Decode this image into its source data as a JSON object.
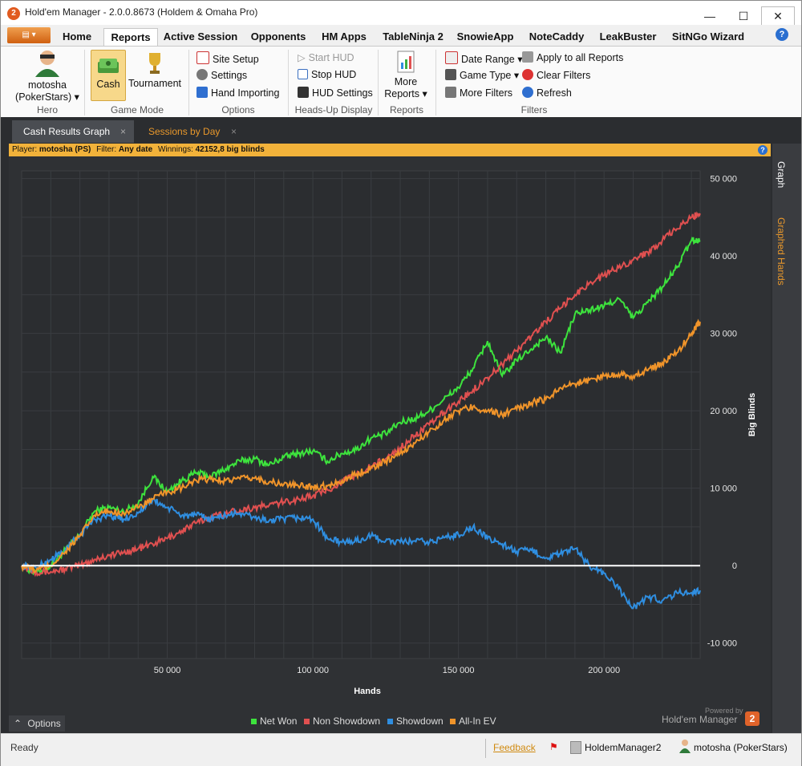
{
  "window": {
    "title": "Hold'em Manager - 2.0.0.8673 (Holdem & Omaha Pro)",
    "app_icon": "2",
    "minimize": "—",
    "maximize": "☐",
    "close": "✕"
  },
  "menu_tabs": [
    "Home",
    "Reports",
    "Active Session",
    "Opponents",
    "HM Apps",
    "TableNinja 2",
    "SnowieApp",
    "NoteCaddy",
    "LeakBuster",
    "SitNGo Wizard"
  ],
  "active_tab": "Reports",
  "ribbon": {
    "hero": {
      "name": "motosha",
      "site": "(PokerStars)",
      "label": "Hero"
    },
    "game_mode": {
      "cash": "Cash",
      "tournament": "Tournament",
      "label": "Game Mode"
    },
    "options": {
      "site_setup": "Site Setup",
      "settings": "Settings",
      "hand_importing": "Hand Importing",
      "label": "Options"
    },
    "hud": {
      "start": "Start HUD",
      "stop": "Stop HUD",
      "settings": "HUD Settings",
      "label": "Heads-Up Display"
    },
    "reports": {
      "more1": "More",
      "more2": "Reports",
      "label": "Reports"
    },
    "filters": {
      "date_range": "Date Range",
      "game_type": "Game Type",
      "more_filters": "More Filters",
      "apply_all": "Apply to all Reports",
      "clear": "Clear Filters",
      "refresh": "Refresh",
      "label": "Filters"
    }
  },
  "doc_tabs": [
    "Cash Results Graph",
    "Sessions by Day"
  ],
  "infobar": {
    "player_label": "Player:",
    "player": "motosha (PS)",
    "filter_label": "Filter:",
    "filter": "Any date",
    "winnings_label": "Winnings:",
    "winnings": "42152,8 big blinds"
  },
  "side_tabs": [
    "Graph",
    "Graphed Hands"
  ],
  "options_button": "Options",
  "powered_by": "Powered by",
  "brand": "Hold'em Manager",
  "status": {
    "ready": "Ready",
    "feedback": "Feedback",
    "db": "HoldemManager2",
    "user": "motosha (PokerStars)"
  },
  "chart_data": {
    "type": "line",
    "xlabel": "Hands",
    "ylabel": "Big Blinds",
    "xlim": [
      0,
      233000
    ],
    "ylim": [
      -12000,
      51000
    ],
    "xticks": [
      50000,
      100000,
      150000,
      200000
    ],
    "xtick_labels": [
      "50 000",
      "100 000",
      "150 000",
      "200 000"
    ],
    "yticks": [
      -10000,
      0,
      10000,
      20000,
      30000,
      40000,
      50000
    ],
    "ytick_labels": [
      "-10 000",
      "0",
      "10 000",
      "20 000",
      "30 000",
      "40 000",
      "50 000"
    ],
    "grid": true,
    "legend_position": "bottom",
    "x": [
      0,
      5000,
      10000,
      15000,
      20000,
      25000,
      30000,
      35000,
      40000,
      45000,
      50000,
      55000,
      60000,
      65000,
      70000,
      75000,
      80000,
      85000,
      90000,
      95000,
      100000,
      105000,
      110000,
      115000,
      120000,
      125000,
      130000,
      135000,
      140000,
      145000,
      150000,
      155000,
      160000,
      165000,
      170000,
      175000,
      180000,
      185000,
      190000,
      195000,
      200000,
      205000,
      210000,
      215000,
      220000,
      225000,
      230000,
      233000
    ],
    "series": [
      {
        "name": "Net Won",
        "color": "#3de33d",
        "values": [
          0,
          -1000,
          0,
          2000,
          4000,
          7000,
          7500,
          7000,
          8000,
          11500,
          9500,
          11000,
          12000,
          11500,
          12500,
          13500,
          13800,
          13000,
          14000,
          14500,
          14800,
          13500,
          14500,
          15000,
          16500,
          17000,
          18500,
          19000,
          20000,
          21500,
          23000,
          25500,
          29000,
          24500,
          26500,
          28000,
          29500,
          27500,
          32500,
          33000,
          33500,
          34500,
          32000,
          34000,
          36000,
          38500,
          42000,
          42000
        ]
      },
      {
        "name": "Non Showdown",
        "color": "#e05050",
        "values": [
          0,
          -800,
          -800,
          -400,
          0,
          800,
          1300,
          1700,
          2200,
          2800,
          3500,
          4500,
          5500,
          6300,
          6800,
          7200,
          7500,
          7800,
          8200,
          8600,
          9000,
          9800,
          10800,
          11800,
          12800,
          13800,
          15200,
          16800,
          18200,
          19800,
          21200,
          22700,
          24300,
          26000,
          27800,
          29600,
          31500,
          33200,
          35000,
          36500,
          37500,
          38500,
          39500,
          40500,
          42000,
          43500,
          45000,
          45500
        ]
      },
      {
        "name": "Showdown",
        "color": "#2f8ee0",
        "values": [
          0,
          -300,
          800,
          2000,
          4000,
          6000,
          6500,
          6000,
          6800,
          8500,
          7500,
          6500,
          6500,
          6000,
          6500,
          6800,
          6200,
          5800,
          6000,
          6200,
          6000,
          3500,
          3000,
          3200,
          3800,
          3200,
          3000,
          3200,
          3000,
          3600,
          4000,
          5000,
          3500,
          2800,
          1800,
          2000,
          1000,
          1500,
          2200,
          0,
          -1000,
          -3000,
          -5500,
          -4000,
          -4500,
          -3500,
          -3500,
          -3200
        ]
      },
      {
        "name": "All-In EV",
        "color": "#f0942a",
        "values": [
          0,
          -600,
          0,
          1800,
          3800,
          6500,
          7000,
          6800,
          7500,
          8600,
          9500,
          10000,
          11000,
          11200,
          11000,
          11200,
          11300,
          10800,
          10500,
          10300,
          10200,
          10300,
          11000,
          11800,
          12600,
          13500,
          14500,
          15800,
          17300,
          18800,
          20000,
          20500,
          20000,
          19500,
          20200,
          21000,
          21500,
          23000,
          23500,
          24000,
          24500,
          24800,
          24500,
          25200,
          26200,
          27500,
          30000,
          31500
        ]
      }
    ],
    "zero_line_color": "#ffffff"
  }
}
